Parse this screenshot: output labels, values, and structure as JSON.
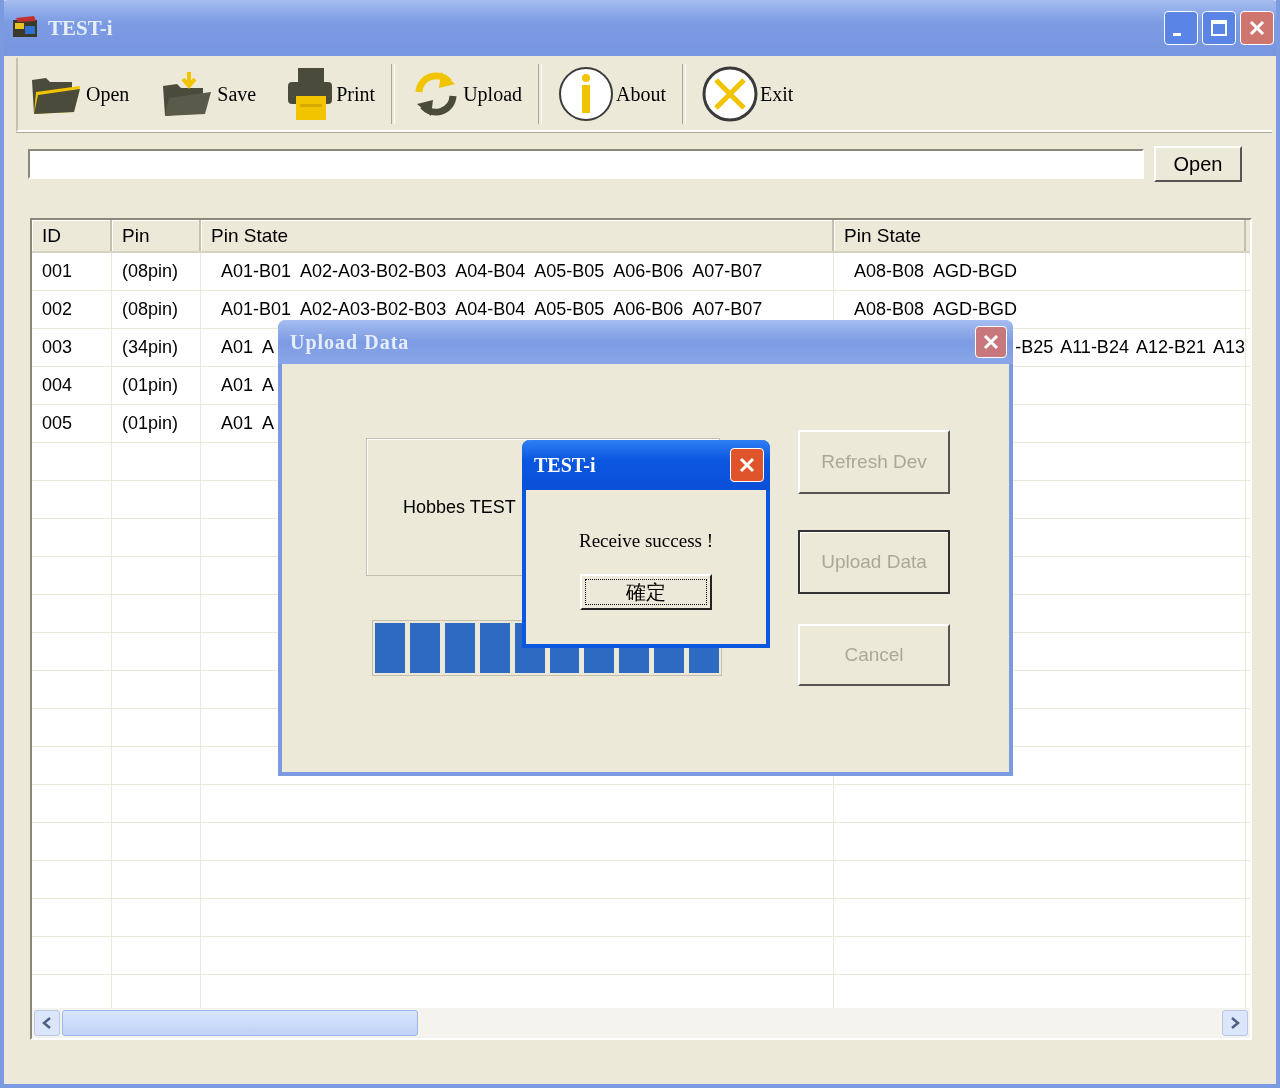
{
  "window": {
    "title": "TEST-i"
  },
  "toolbar": [
    {
      "kind": "open",
      "label": "Open"
    },
    {
      "kind": "save",
      "label": "Save"
    },
    {
      "kind": "print",
      "label": "Print"
    },
    {
      "kind": "upload",
      "label": "Upload"
    },
    {
      "kind": "about",
      "label": "About"
    },
    {
      "kind": "exit",
      "label": "Exit"
    }
  ],
  "path_bar": {
    "button": "Open"
  },
  "table": {
    "columns": [
      "ID",
      "Pin",
      "Pin State",
      "Pin State"
    ],
    "rows": [
      {
        "clipped": false,
        "cells": [
          "001",
          "(08pin)",
          "A01-B01  A02-A03-B02-B03  A04-B04  A05-B05  A06-B06  A07-B07",
          "A08-B08  AGD-BGD"
        ]
      },
      {
        "clipped": false,
        "cells": [
          "002",
          "(08pin)",
          "A01-B01  A02-A03-B02-B03  A04-B04  A05-B05  A06-B06  A07-B07",
          "A08-B08  AGD-BGD"
        ]
      },
      {
        "clipped": true,
        "cells": [
          "003",
          "(34pin)",
          "A01  A",
          "-B25 A11-B24 A12-B21 A13"
        ]
      },
      {
        "cells": [
          "004",
          "(01pin)",
          "A01  A",
          ""
        ]
      },
      {
        "cells": [
          "005",
          "(01pin)",
          "A01  A",
          ""
        ]
      }
    ]
  },
  "upload_dialog": {
    "title": "Upload Data",
    "device": "Hobbes TEST",
    "progress": {
      "level": 1
    },
    "buttons": [
      {
        "label": "Refresh Dev",
        "disabled": true,
        "default": false
      },
      {
        "label": "Upload Data",
        "disabled": true,
        "default": true
      },
      {
        "label": "Cancel",
        "disabled": true,
        "default": false
      }
    ]
  },
  "message_box": {
    "title": "TEST-i",
    "message": "Receive success !",
    "button": "確定"
  }
}
